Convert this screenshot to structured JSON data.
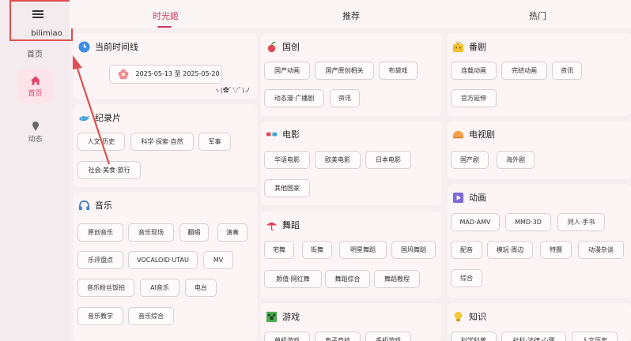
{
  "sidebar": {
    "app_name": "bilimiao",
    "home_top_label": "首页",
    "home_label": "首页",
    "dynamic_label": "动态"
  },
  "tabs": [
    "时光姬",
    "推荐",
    "热门"
  ],
  "col1": {
    "timeline": {
      "title": "当前时间线",
      "date_range": "2025-05-13 至 2025-05-20",
      "kaomoji": "ヽ(✿ﾟ▽ﾟ)ノ"
    },
    "documentary": {
      "title": "纪录片",
      "chips": [
        "人文·历史",
        "科学·探索·自然",
        "军事",
        "社会·美食·旅行"
      ]
    },
    "music": {
      "title": "音乐",
      "chips": [
        "原创音乐",
        "音乐现场",
        "翻唱",
        "演奏",
        "乐评盘点",
        "VOCALOID·UTAU",
        "MV",
        "音乐粉丝饭拍",
        "AI音乐",
        "电台",
        "音乐教学",
        "音乐综合"
      ]
    }
  },
  "col2": {
    "guochuang": {
      "title": "国创",
      "chips": [
        "国产动画",
        "国产原创相关",
        "布袋戏",
        "动态漫·广播剧",
        "资讯"
      ]
    },
    "movie": {
      "title": "电影",
      "chips": [
        "华语电影",
        "欧美电影",
        "日本电影",
        "其他国家"
      ]
    },
    "dance": {
      "title": "舞蹈",
      "chips": [
        "宅舞",
        "街舞",
        "明星舞蹈",
        "国风舞蹈",
        "颜值·网红舞",
        "舞蹈综合",
        "舞蹈教程"
      ]
    },
    "game": {
      "title": "游戏",
      "chips": [
        "单机游戏",
        "电子竞技",
        "手机游戏"
      ]
    }
  },
  "col3": {
    "fanju": {
      "title": "番剧",
      "chips": [
        "连载动画",
        "完结动画",
        "资讯",
        "官方延伸"
      ]
    },
    "tvseries": {
      "title": "电视剧",
      "chips": [
        "国产剧",
        "海外剧"
      ]
    },
    "anime": {
      "title": "动画",
      "chips": [
        "MAD·AMV",
        "MMD·3D",
        "同人·手书",
        "配音",
        "模玩·周边",
        "特摄",
        "动漫杂谈",
        "综合"
      ]
    },
    "knowledge": {
      "title": "知识",
      "chips": [
        "科学科普",
        "社科·法律·心理",
        "人文历史"
      ]
    }
  },
  "colors": {
    "accent": "#c8385a",
    "highlight_box": "#e0504e"
  }
}
